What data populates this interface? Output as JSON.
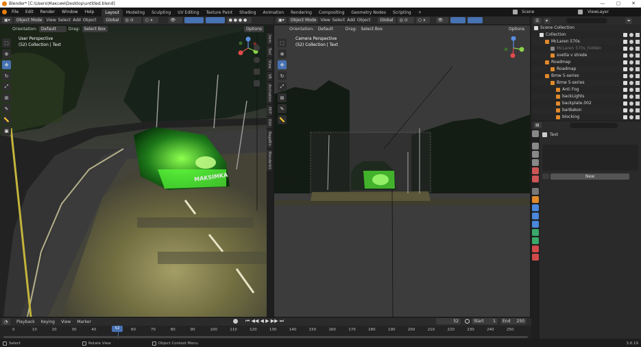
{
  "window": {
    "title": "Blender* [C:\\Users\\Максим\\Desktop\\untitled.blend]",
    "min": "—",
    "max": "▢",
    "close": "✕"
  },
  "menu": [
    "File",
    "Edit",
    "Render",
    "Window",
    "Help"
  ],
  "workspaces": [
    "Layout",
    "Modeling",
    "Sculpting",
    "UV Editing",
    "Texture Paint",
    "Shading",
    "Animation",
    "Rendering",
    "Compositing",
    "Geometry Nodes",
    "Scripting"
  ],
  "workspace_add": "+",
  "scene": {
    "label": "Scene",
    "view_layer": "ViewLayer"
  },
  "left_viewport": {
    "mode": "Object Mode",
    "menus": [
      "View",
      "Select",
      "Add",
      "Object"
    ],
    "transform": "Global",
    "orientation_label": "Orientation:",
    "orientation": "Default",
    "drag_label": "Drag:",
    "drag": "Select Box",
    "options": "Options",
    "overlay_title": "User Perspective",
    "overlay_sub": "(52) Collection | Text",
    "watermark": "MAKSIMKA",
    "npanel_tabs": [
      "Item",
      "Tool",
      "View",
      "VR",
      "Animation",
      "PDT",
      "Edit",
      "BagaBin",
      "Blenderkit"
    ]
  },
  "right_viewport": {
    "mode": "Object Mode",
    "menus": [
      "View",
      "Select",
      "Add",
      "Object"
    ],
    "transform": "Global",
    "orientation_label": "Orientation:",
    "orientation": "Default",
    "drag_label": "Drag:",
    "drag": "Select Box",
    "options": "Options",
    "overlay_title": "Camera Perspective",
    "overlay_sub": "(52) Collection | Text"
  },
  "gizmo": {
    "x": "X",
    "y": "Y",
    "z": "Z"
  },
  "outliner": {
    "search_placeholder": "",
    "items": [
      {
        "label": "Scene Collection",
        "indent": 0
      },
      {
        "label": "Collection",
        "indent": 1
      },
      {
        "label": "McLaren 570s",
        "indent": 2
      },
      {
        "label": "McLaren 570s_hidden",
        "indent": 3,
        "dim": true
      },
      {
        "label": "svetla v strede",
        "indent": 3
      },
      {
        "label": "Roadmap",
        "indent": 2
      },
      {
        "label": "Roadmap",
        "indent": 3
      },
      {
        "label": "Bmw 5-series",
        "indent": 2
      },
      {
        "label": "Bmw 5-series",
        "indent": 3
      },
      {
        "label": "Anti Fog",
        "indent": 4
      },
      {
        "label": "backLights",
        "indent": 4
      },
      {
        "label": "backplate.002",
        "indent": 4
      },
      {
        "label": "barBakon",
        "indent": 4
      },
      {
        "label": "blocking",
        "indent": 4
      }
    ]
  },
  "properties": {
    "object_name": "Text",
    "new_button": "New"
  },
  "timeline": {
    "menus": [
      "Playback",
      "Keying",
      "View",
      "Marker"
    ],
    "current_frame": "52",
    "start_label": "Start",
    "start": "1",
    "end_label": "End",
    "end": "250",
    "ticks": [
      "0",
      "10",
      "20",
      "30",
      "40",
      "52",
      "60",
      "70",
      "80",
      "90",
      "100",
      "110",
      "120",
      "130",
      "140",
      "150",
      "160",
      "170",
      "180",
      "190",
      "200",
      "210",
      "220",
      "230",
      "240",
      "250"
    ]
  },
  "statusbar": {
    "select": "Select",
    "rotate": "Rotate View",
    "context": "Object Context Menu",
    "version": "3.6.19"
  },
  "colors": {
    "accent": "#4772b3",
    "frame": "#4772b3",
    "header": "#2b2b2b",
    "panel": "#303030"
  }
}
